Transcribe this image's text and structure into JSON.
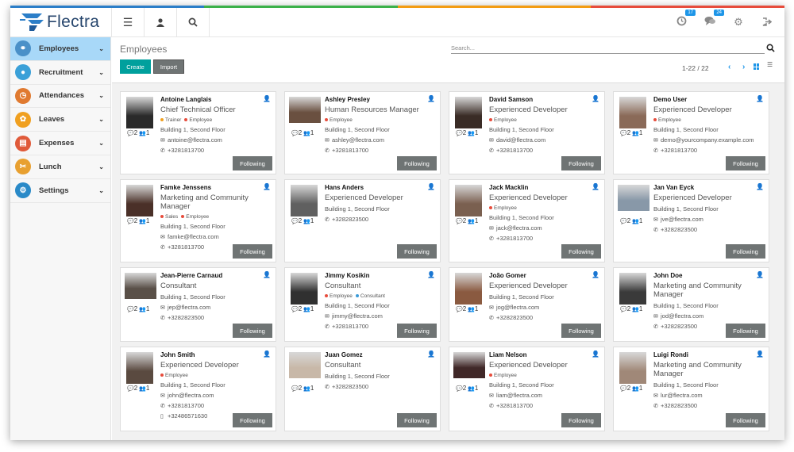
{
  "app": {
    "logo_text": "Flectra"
  },
  "brand_colors": [
    "#2b7ec8",
    "#3cb14a",
    "#f39c12",
    "#e74c3c"
  ],
  "topbar": {
    "menu_icon": "hamburger-icon",
    "user_icon": "user-icon",
    "search_icon": "search-icon",
    "activity_badge": "17",
    "messages_badge": "24",
    "settings_icon": "gears-icon",
    "logout_icon": "sign-out-icon"
  },
  "sidebar": {
    "items": [
      {
        "label": "Employees",
        "icon": "org-chart-icon",
        "color": "#4a90c8",
        "active": true
      },
      {
        "label": "Recruitment",
        "icon": "recruit-icon",
        "color": "#3aa0d8",
        "active": false
      },
      {
        "label": "Attendances",
        "icon": "attendance-icon",
        "color": "#e07a30",
        "active": false
      },
      {
        "label": "Leaves",
        "icon": "leaves-icon",
        "color": "#f0a020",
        "active": false
      },
      {
        "label": "Expenses",
        "icon": "expenses-icon",
        "color": "#e05a3a",
        "active": false
      },
      {
        "label": "Lunch",
        "icon": "lunch-icon",
        "color": "#e8a030",
        "active": false
      },
      {
        "label": "Settings",
        "icon": "settings-icon",
        "color": "#2a8ac8",
        "active": false
      }
    ]
  },
  "control_panel": {
    "title": "Employees",
    "search_placeholder": "Search...",
    "create_label": "Create",
    "import_label": "Import",
    "pager": "1-22 / 22"
  },
  "employees": [
    {
      "name": "Antoine Langlais",
      "job": "Chief Technical Officer",
      "tags": [
        [
          "Trainer",
          "#f0a020"
        ],
        [
          "Employee",
          "#e74c3c"
        ]
      ],
      "location": "Building 1, Second Floor",
      "email": "antoine@flectra.com",
      "phone": "+3281813700",
      "mobile": "",
      "followers": "2",
      "following": "1",
      "button": "Following",
      "photo_tone": "#2a2a2a"
    },
    {
      "name": "Ashley Presley",
      "job": "Human Resources Manager",
      "tags": [
        [
          "Employee",
          "#e74c3c"
        ]
      ],
      "location": "Building 1, Second Floor",
      "email": "ashley@flectra.com",
      "phone": "+3281813700",
      "mobile": "",
      "followers": "2",
      "following": "1",
      "button": "Following",
      "photo_tone": "#6a5040"
    },
    {
      "name": "David Samson",
      "job": "Experienced Developer",
      "tags": [
        [
          "Employee",
          "#e74c3c"
        ]
      ],
      "location": "Building 1, Second Floor",
      "email": "david@flectra.com",
      "phone": "+3281813700",
      "mobile": "",
      "followers": "2",
      "following": "1",
      "button": "Following",
      "photo_tone": "#3a2c26"
    },
    {
      "name": "Demo User",
      "job": "Experienced Developer",
      "tags": [
        [
          "Employee",
          "#e74c3c"
        ]
      ],
      "location": "Building 1, Second Floor",
      "email": "demo@yourcompany.example.com",
      "phone": "+3281813700",
      "mobile": "",
      "followers": "2",
      "following": "1",
      "button": "Following",
      "photo_tone": "#8a6a58"
    },
    {
      "name": "Famke Jenssens",
      "job": "Marketing and Community Manager",
      "tags": [
        [
          "Sales",
          "#e74c3c"
        ],
        [
          "Employee",
          "#e74c3c"
        ]
      ],
      "location": "Building 1, Second Floor",
      "email": "famke@flectra.com",
      "phone": "+3281813700",
      "mobile": "",
      "followers": "2",
      "following": "1",
      "button": "Following",
      "photo_tone": "#4a3028"
    },
    {
      "name": "Hans Anders",
      "job": "Experienced Developer",
      "tags": [],
      "location": "Building 1, Second Floor",
      "email": "",
      "phone": "+3282823500",
      "mobile": "",
      "followers": "2",
      "following": "1",
      "button": "Following",
      "photo_tone": "#606060"
    },
    {
      "name": "Jack Macklin",
      "job": "Experienced Developer",
      "tags": [
        [
          "Employee",
          "#e74c3c"
        ]
      ],
      "location": "Building 1, Second Floor",
      "email": "jack@flectra.com",
      "phone": "+3281813700",
      "mobile": "",
      "followers": "2",
      "following": "1",
      "button": "Following",
      "photo_tone": "#7a6050"
    },
    {
      "name": "Jan Van Eyck",
      "job": "Experienced Developer",
      "tags": [],
      "location": "Building 1, Second Floor",
      "email": "jve@flectra.com",
      "phone": "+3282823500",
      "mobile": "",
      "followers": "2",
      "following": "1",
      "button": "Following",
      "photo_tone": "#8898a8"
    },
    {
      "name": "Jean-Pierre Carnaud",
      "job": "Consultant",
      "tags": [],
      "location": "Building 1, Second Floor",
      "email": "jep@flectra.com",
      "phone": "+3282823500",
      "mobile": "",
      "followers": "2",
      "following": "1",
      "button": "Following",
      "photo_tone": "#5a5048"
    },
    {
      "name": "Jimmy Kosikin",
      "job": "Consultant",
      "tags": [
        [
          "Employee",
          "#e74c3c"
        ],
        [
          "Consultant",
          "#3a9ad8"
        ]
      ],
      "location": "Building 1, Second Floor",
      "email": "jimmy@flectra.com",
      "phone": "+3281813700",
      "mobile": "",
      "followers": "2",
      "following": "1",
      "button": "Following",
      "photo_tone": "#303030"
    },
    {
      "name": "João Gomer",
      "job": "Experienced Developer",
      "tags": [],
      "location": "Building 1, Second Floor",
      "email": "jog@flectra.com",
      "phone": "+3282823500",
      "mobile": "",
      "followers": "2",
      "following": "1",
      "button": "Following",
      "photo_tone": "#8a5a40"
    },
    {
      "name": "John Doe",
      "job": "Marketing and Community Manager",
      "tags": [],
      "location": "Building 1, Second Floor",
      "email": "jod@flectra.com",
      "phone": "+3282823500",
      "mobile": "",
      "followers": "2",
      "following": "1",
      "button": "Following",
      "photo_tone": "#3a3a3a"
    },
    {
      "name": "John Smith",
      "job": "Experienced Developer",
      "tags": [
        [
          "Employee",
          "#e74c3c"
        ]
      ],
      "location": "Building 1, Second Floor",
      "email": "john@flectra.com",
      "phone": "+3281813700",
      "mobile": "+32486571630",
      "followers": "2",
      "following": "1",
      "button": "Following",
      "photo_tone": "#5a4a40"
    },
    {
      "name": "Juan Gomez",
      "job": "Consultant",
      "tags": [],
      "location": "Building 1, Second Floor",
      "email": "",
      "phone": "+3282823500",
      "mobile": "",
      "followers": "2",
      "following": "1",
      "button": "Following",
      "photo_tone": "#c8b8a8"
    },
    {
      "name": "Liam Nelson",
      "job": "Experienced Developer",
      "tags": [
        [
          "Employee",
          "#e74c3c"
        ]
      ],
      "location": "Building 1, Second Floor",
      "email": "liam@flectra.com",
      "phone": "+3281813700",
      "mobile": "",
      "followers": "2",
      "following": "1",
      "button": "Following",
      "photo_tone": "#402828"
    },
    {
      "name": "Luigi Rondi",
      "job": "Marketing and Community Manager",
      "tags": [],
      "location": "Building 1, Second Floor",
      "email": "lur@flectra.com",
      "phone": "+3282823500",
      "mobile": "",
      "followers": "2",
      "following": "1",
      "button": "Following",
      "photo_tone": "#a08878"
    }
  ]
}
